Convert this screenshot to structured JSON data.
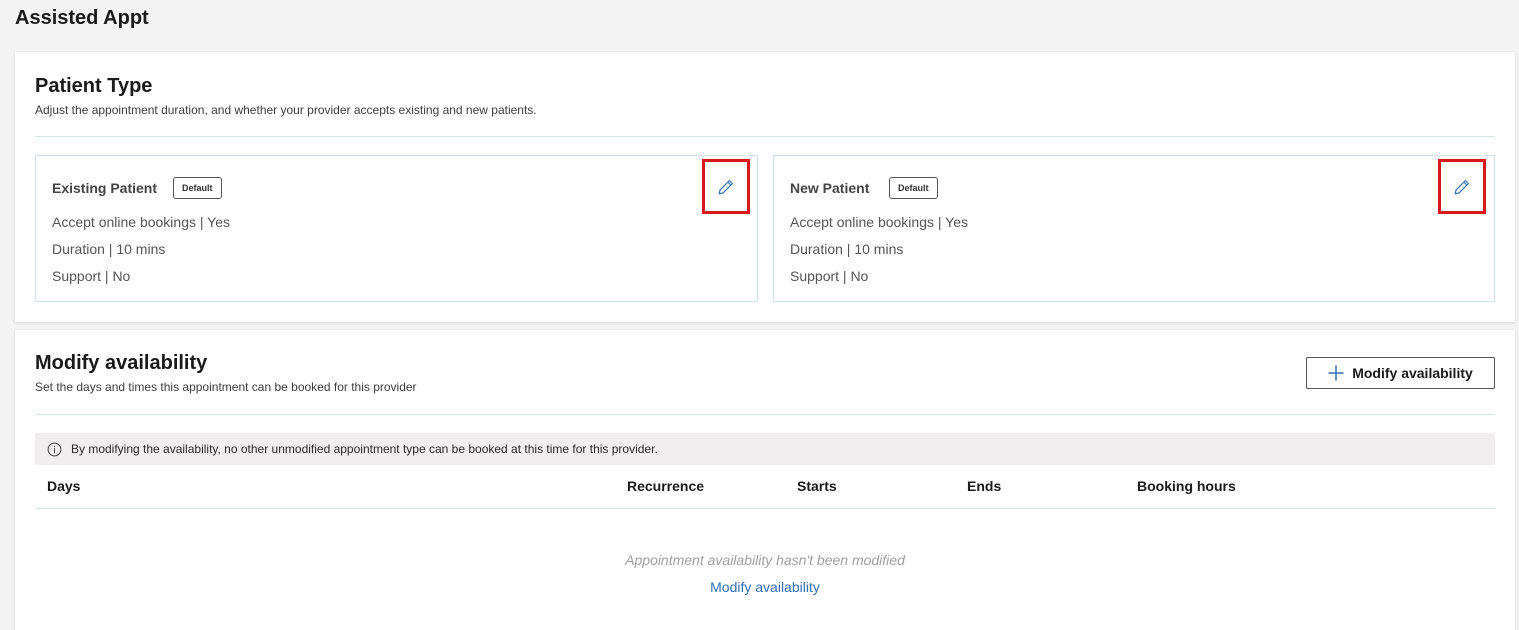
{
  "page": {
    "title": "Assisted Appt"
  },
  "patient_type": {
    "title": "Patient Type",
    "subtitle": "Adjust the appointment duration, and whether your provider accepts existing and new patients.",
    "cards": [
      {
        "title": "Existing Patient",
        "badge": "Default",
        "online": "Accept online bookings | Yes",
        "duration": "Duration | 10 mins",
        "support": "Support | No",
        "edit_icon": "pencil-icon"
      },
      {
        "title": "New Patient",
        "badge": "Default",
        "online": "Accept online bookings | Yes",
        "duration": "Duration | 10 mins",
        "support": "Support | No",
        "edit_icon": "pencil-icon"
      }
    ]
  },
  "availability": {
    "title": "Modify availability",
    "subtitle": "Set the days and times this appointment can be booked for this provider",
    "button_label": "Modify availability",
    "button_icon": "plus-icon",
    "info_text": "By modifying the availability, no other unmodified appointment type can be booked at this time for this provider.",
    "info_icon": "info-icon",
    "columns": [
      "Days",
      "Recurrence",
      "Starts",
      "Ends",
      "Booking hours"
    ],
    "empty_message": "Appointment availability hasn't been modified",
    "empty_link": "Modify availability"
  },
  "colors": {
    "highlight_red": "#d7191c",
    "link_blue": "#2f6fb5",
    "card_border": "#cde5e5"
  }
}
